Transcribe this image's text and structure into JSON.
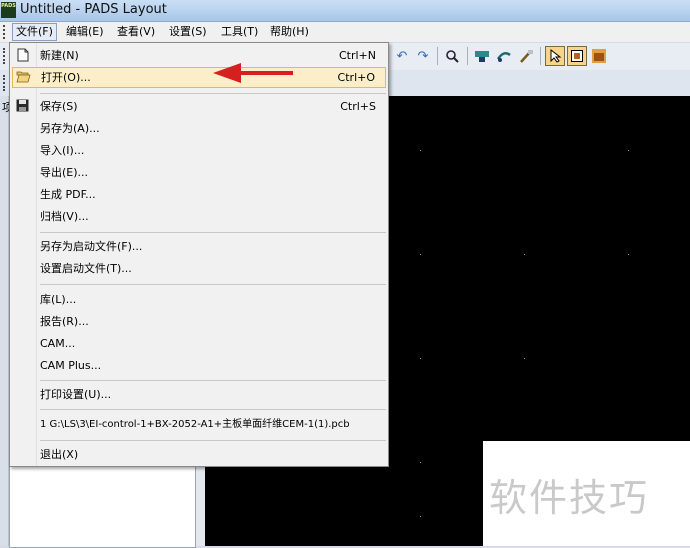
{
  "window": {
    "title": "Untitled - PADS Layout",
    "icon_text": "PADS"
  },
  "menubar": {
    "items": [
      {
        "label": "文件(F)"
      },
      {
        "label": "编辑(E)"
      },
      {
        "label": "查看(V)"
      },
      {
        "label": "设置(S)"
      },
      {
        "label": "工具(T)"
      },
      {
        "label": "帮助(H)"
      }
    ]
  },
  "file_menu": {
    "items": [
      {
        "label": "新建(N)",
        "shortcut": "Ctrl+N",
        "icon": "new-file-icon"
      },
      {
        "label": "打开(O)...",
        "shortcut": "Ctrl+O",
        "icon": "open-folder-icon"
      },
      {
        "label": "保存(S)",
        "shortcut": "Ctrl+S",
        "icon": "save-icon"
      },
      {
        "label": "另存为(A)..."
      },
      {
        "label": "导入(I)..."
      },
      {
        "label": "导出(E)..."
      },
      {
        "label": "生成 PDF..."
      },
      {
        "label": "归档(V)..."
      },
      {
        "label": "另存为启动文件(F)..."
      },
      {
        "label": "设置启动文件(T)..."
      },
      {
        "label": "库(L)..."
      },
      {
        "label": "报告(R)..."
      },
      {
        "label": "CAM..."
      },
      {
        "label": "CAM Plus..."
      },
      {
        "label": "打印设置(U)..."
      },
      {
        "label": "1 G:\\LS\\3\\EI-control-1+BX-2052-A1+主板单面纤维CEM-1(1).pcb"
      },
      {
        "label": "退出(X)"
      }
    ]
  },
  "left_panel": {
    "tab_label": "项"
  },
  "watermark": {
    "text": "软件技巧"
  },
  "colors": {
    "arrow": "#d61f1f",
    "highlight": "#fbeec8",
    "canvas": "#000000"
  }
}
